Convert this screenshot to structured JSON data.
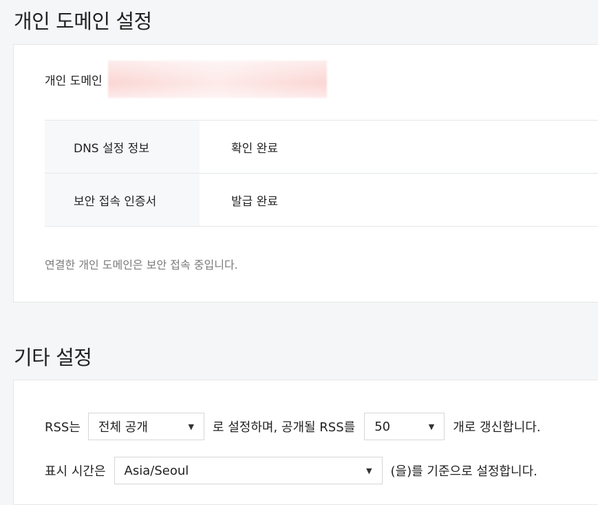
{
  "domain_section": {
    "title": "개인 도메인 설정",
    "domain_label": "개인 도메인",
    "rows": [
      {
        "label": "DNS 설정 정보",
        "value": "확인 완료"
      },
      {
        "label": "보안 접속 인증서",
        "value": "발급 완료"
      }
    ],
    "note": "연결한 개인 도메인은 보안 접속 중입니다."
  },
  "other_section": {
    "title": "기타 설정",
    "rss": {
      "prefix": "RSS는",
      "scope_value": "전체 공개",
      "middle": "로 설정하며, 공개될 RSS를",
      "count_value": "50",
      "suffix": "개로 갱신합니다."
    },
    "timezone": {
      "prefix": "표시 시간은",
      "value": "Asia/Seoul",
      "suffix": "(을)를 기준으로 설정합니다."
    }
  },
  "icons": {
    "dropdown": "caret-down-icon"
  }
}
